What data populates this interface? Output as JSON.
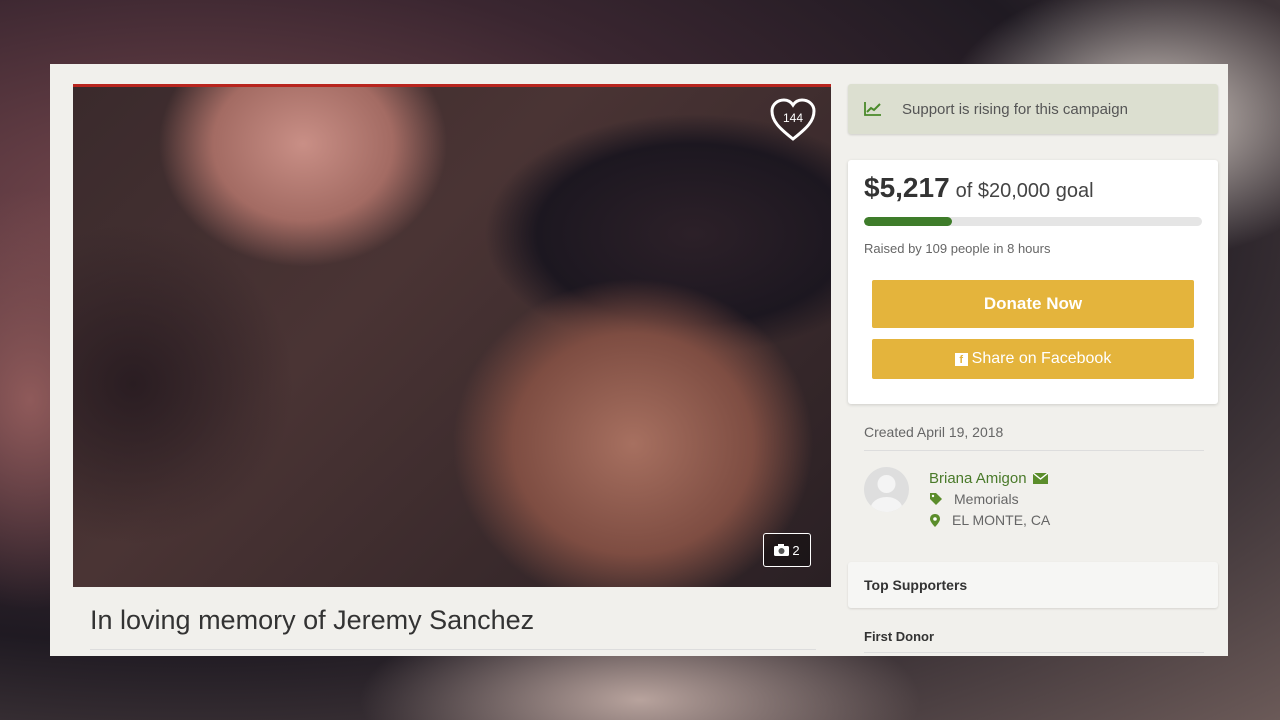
{
  "campaign": {
    "title": "In loving memory of Jeremy Sanchez",
    "hearts": "144",
    "photo_count": "2"
  },
  "support_banner": {
    "text": "Support is rising for this campaign"
  },
  "donation": {
    "amount": "$5,217",
    "goal_text": "of $20,000 goal",
    "progress_fraction": 0.26,
    "raised_text": "Raised by 109 people in 8 hours",
    "donate_label": "Donate Now",
    "share_label": "Share on Facebook"
  },
  "details": {
    "created": "Created April 19, 2018",
    "organizer": "Briana Amigon",
    "category": "Memorials",
    "location": "EL MONTE, CA"
  },
  "sections": {
    "top_supporters": "Top Supporters",
    "first_donor": "First Donor"
  },
  "colors": {
    "accent_green": "#3e7c2a",
    "button_yellow": "#e4b43c"
  },
  "icons": [
    "heart-icon",
    "camera-icon",
    "trend-chart-icon",
    "facebook-icon",
    "mail-icon",
    "tag-icon",
    "location-pin-icon"
  ]
}
